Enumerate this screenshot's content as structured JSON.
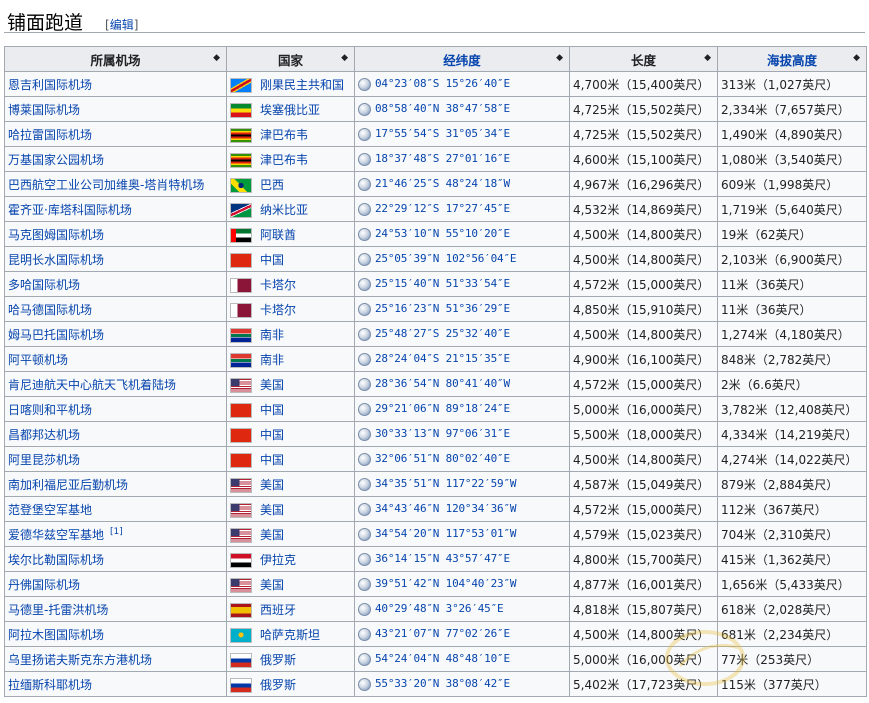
{
  "section": {
    "title": "铺面跑道",
    "edit_open": "[",
    "edit_label": "编辑",
    "edit_close": "]"
  },
  "table": {
    "columns": [
      {
        "label": "所属机场",
        "link": false
      },
      {
        "label": "国家",
        "link": false
      },
      {
        "label": "经纬度",
        "link": true
      },
      {
        "label": "长度",
        "link": false
      },
      {
        "label": "海拔高度",
        "link": true
      }
    ],
    "sort_icon": "◆",
    "rows": [
      {
        "airport": "恩吉利国际机场",
        "ref": "",
        "country": "刚果民主共和国",
        "flag": "flag-drc",
        "coord": "04°23′08″S 15°26′40″E",
        "length": "4,700米（15,400英尺）",
        "elevation": "313米（1,027英尺）"
      },
      {
        "airport": "博莱国际机场",
        "ref": "",
        "country": "埃塞俄比亚",
        "flag": "flag-ethiopia",
        "coord": "08°58′40″N 38°47′58″E",
        "length": "4,725米（15,502英尺）",
        "elevation": "2,334米（7,657英尺）"
      },
      {
        "airport": "哈拉雷国际机场",
        "ref": "",
        "country": "津巴布韦",
        "flag": "flag-zimbabwe",
        "coord": "17°55′54″S 31°05′34″E",
        "length": "4,725米（15,502英尺）",
        "elevation": "1,490米（4,890英尺）"
      },
      {
        "airport": "万基国家公园机场",
        "ref": "",
        "country": "津巴布韦",
        "flag": "flag-zimbabwe",
        "coord": "18°37′48″S 27°01′16″E",
        "length": "4,600米（15,100英尺）",
        "elevation": "1,080米（3,540英尺）"
      },
      {
        "airport": "巴西航空工业公司加维奥-塔肖特机场",
        "ref": "",
        "country": "巴西",
        "flag": "flag-brazil",
        "coord": "21°46′25″S 48°24′18″W",
        "length": "4,967米（16,296英尺）",
        "elevation": "609米（1,998英尺）"
      },
      {
        "airport": "霍齐亚·库塔科国际机场",
        "ref": "",
        "country": "纳米比亚",
        "flag": "flag-namibia",
        "coord": "22°29′12″S 17°27′45″E",
        "length": "4,532米（14,869英尺）",
        "elevation": "1,719米（5,640英尺）"
      },
      {
        "airport": "马克图姆国际机场",
        "ref": "",
        "country": "阿联酋",
        "flag": "flag-uae",
        "coord": "24°53′10″N 55°10′20″E",
        "length": "4,500米（14,800英尺）",
        "elevation": "19米（62英尺）"
      },
      {
        "airport": "昆明长水国际机场",
        "ref": "",
        "country": "中国",
        "flag": "flag-china",
        "coord": "25°05′39″N 102°56′04″E",
        "length": "4,500米（14,800英尺）",
        "elevation": "2,103米（6,900英尺）"
      },
      {
        "airport": "多哈国际机场",
        "ref": "",
        "country": "卡塔尔",
        "flag": "flag-qatar",
        "coord": "25°15′40″N 51°33′54″E",
        "length": "4,572米（15,000英尺）",
        "elevation": "11米（36英尺）"
      },
      {
        "airport": "哈马德国际机场",
        "ref": "",
        "country": "卡塔尔",
        "flag": "flag-qatar",
        "coord": "25°16′23″N 51°36′29″E",
        "length": "4,850米（15,910英尺）",
        "elevation": "11米（36英尺）"
      },
      {
        "airport": "姆马巴托国际机场",
        "ref": "",
        "country": "南非",
        "flag": "flag-south-africa",
        "coord": "25°48′27″S 25°32′40″E",
        "length": "4,500米（14,800英尺）",
        "elevation": "1,274米（4,180英尺）"
      },
      {
        "airport": "阿平顿机场",
        "ref": "",
        "country": "南非",
        "flag": "flag-south-africa",
        "coord": "28°24′04″S 21°15′35″E",
        "length": "4,900米（16,100英尺）",
        "elevation": "848米（2,782英尺）"
      },
      {
        "airport": "肯尼迪航天中心航天飞机着陆场",
        "ref": "",
        "country": "美国",
        "flag": "flag-usa",
        "coord": "28°36′54″N 80°41′40″W",
        "length": "4,572米（15,000英尺）",
        "elevation": "2米（6.6英尺）"
      },
      {
        "airport": "日喀则和平机场",
        "ref": "",
        "country": "中国",
        "flag": "flag-china",
        "coord": "29°21′06″N 89°18′24″E",
        "length": "5,000米（16,000英尺）",
        "elevation": "3,782米（12,408英尺）"
      },
      {
        "airport": "昌都邦达机场",
        "ref": "",
        "country": "中国",
        "flag": "flag-china",
        "coord": "30°33′13″N 97°06′31″E",
        "length": "5,500米（18,000英尺）",
        "elevation": "4,334米（14,219英尺）"
      },
      {
        "airport": "阿里昆莎机场",
        "ref": "",
        "country": "中国",
        "flag": "flag-china",
        "coord": "32°06′51″N 80°02′40″E",
        "length": "4,500米（14,800英尺）",
        "elevation": "4,274米（14,022英尺）"
      },
      {
        "airport": "南加利福尼亚后勤机场",
        "ref": "",
        "country": "美国",
        "flag": "flag-usa",
        "coord": "34°35′51″N 117°22′59″W",
        "length": "4,587米（15,049英尺）",
        "elevation": "879米（2,884英尺）"
      },
      {
        "airport": "范登堡空军基地",
        "ref": "",
        "country": "美国",
        "flag": "flag-usa",
        "coord": "34°43′46″N 120°34′36″W",
        "length": "4,572米（15,000英尺）",
        "elevation": "112米（367英尺）"
      },
      {
        "airport": "爱德华兹空军基地",
        "ref": "[1]",
        "country": "美国",
        "flag": "flag-usa",
        "coord": "34°54′20″N 117°53′01″W",
        "length": "4,579米（15,023英尺）",
        "elevation": "704米（2,310英尺）"
      },
      {
        "airport": "埃尔比勒国际机场",
        "ref": "",
        "country": "伊拉克",
        "flag": "flag-iraq",
        "coord": "36°14′15″N 43°57′47″E",
        "length": "4,800米（15,700英尺）",
        "elevation": "415米（1,362英尺）"
      },
      {
        "airport": "丹佛国际机场",
        "ref": "",
        "country": "美国",
        "flag": "flag-usa",
        "coord": "39°51′42″N 104°40′23″W",
        "length": "4,877米（16,001英尺）",
        "elevation": "1,656米（5,433英尺）"
      },
      {
        "airport": "马德里-托雷洪机场",
        "ref": "",
        "country": "西班牙",
        "flag": "flag-spain",
        "coord": "40°29′48″N 3°26′45″E",
        "length": "4,818米（15,807英尺）",
        "elevation": "618米（2,028英尺）"
      },
      {
        "airport": "阿拉木图国际机场",
        "ref": "",
        "country": "哈萨克斯坦",
        "flag": "flag-kazakhstan",
        "coord": "43°21′07″N 77°02′26″E",
        "length": "4,500米（14,800英尺）",
        "elevation": "681米（2,234英尺）"
      },
      {
        "airport": "乌里扬诺夫斯克东方港机场",
        "ref": "",
        "country": "俄罗斯",
        "flag": "flag-russia",
        "coord": "54°24′04″N 48°48′10″E",
        "length": "5,000米（16,000英尺）",
        "elevation": "77米（253英尺）"
      },
      {
        "airport": "拉缅斯科耶机场",
        "ref": "",
        "country": "俄罗斯",
        "flag": "flag-russia",
        "coord": "55°33′20″N 38°08′42″E",
        "length": "5,402米（17,723英尺）",
        "elevation": "115米（377英尺）"
      }
    ]
  }
}
